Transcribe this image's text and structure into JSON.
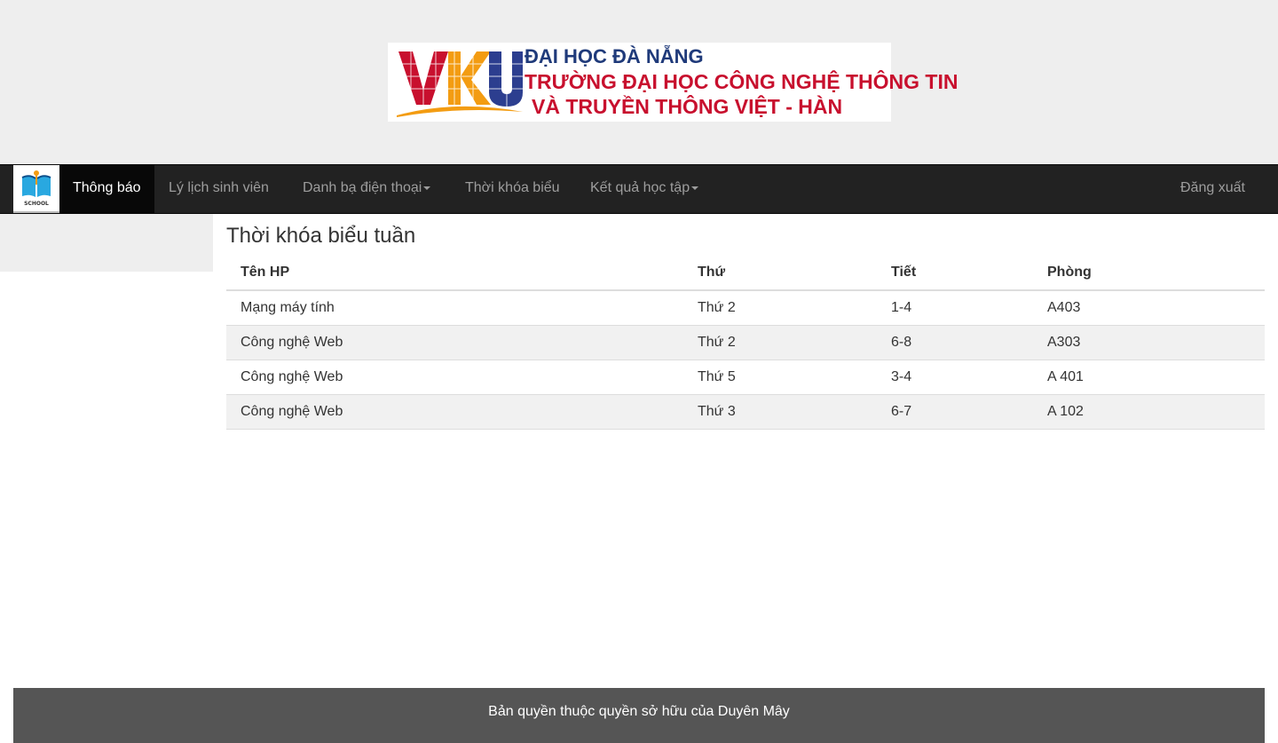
{
  "banner": {
    "logo_letters": "VKU",
    "line1": "ĐẠI HỌC ĐÀ NẴNG",
    "line2": "TRƯỜNG ĐẠI HỌC CÔNG NGHỆ THÔNG TIN",
    "line3": "VÀ TRUYỀN THÔNG VIỆT - HÀN",
    "colors": {
      "navy": "#2c3e8f",
      "red": "#c8102e",
      "orange": "#f39c12"
    }
  },
  "navbar": {
    "brand_text": "SCHOOL",
    "items": [
      {
        "label": "Thông báo",
        "active": true
      },
      {
        "label": "Lý lịch sinh viên"
      },
      {
        "label": "Danh bạ điện thoại",
        "dropdown": true
      },
      {
        "label": "Thời khóa biểu"
      },
      {
        "label": "Kết quả học tập",
        "dropdown": true
      }
    ],
    "logout": "Đăng xuất"
  },
  "main": {
    "title": "Thời khóa biểu tuần",
    "columns": [
      "Tên HP",
      "Thứ",
      "Tiết",
      "Phòng"
    ],
    "rows": [
      {
        "name": "Mạng máy tính",
        "day": "Thứ 2",
        "period": "1-4",
        "room": "A403"
      },
      {
        "name": "Công nghệ Web",
        "day": "Thứ 2",
        "period": "6-8",
        "room": "A303"
      },
      {
        "name": "Công nghệ Web",
        "day": "Thứ 5",
        "period": "3-4",
        "room": "A 401"
      },
      {
        "name": "Công nghệ Web",
        "day": "Thứ 3",
        "period": "6-7",
        "room": "A 102"
      }
    ]
  },
  "footer": {
    "text": "Bản quyền thuộc quyền sở hữu của Duyên Mây"
  }
}
